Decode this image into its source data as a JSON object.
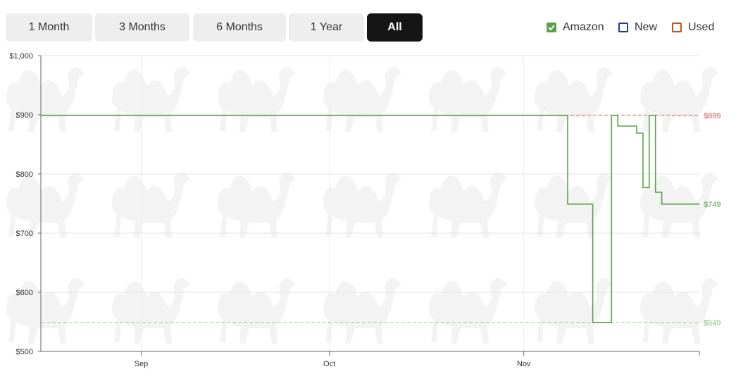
{
  "range_buttons": [
    {
      "label": "1 Month",
      "active": false
    },
    {
      "label": "3 Months",
      "active": false
    },
    {
      "label": "6 Months",
      "active": false
    },
    {
      "label": "1 Year",
      "active": false
    },
    {
      "label": "All",
      "active": true
    }
  ],
  "legend": [
    {
      "label": "Amazon",
      "checked": true,
      "color": "#5ba14a",
      "icon": "checkbox-checked-icon"
    },
    {
      "label": "New",
      "checked": false,
      "color": "#1f3f99",
      "icon": "checkbox-empty-icon"
    },
    {
      "label": "Used",
      "checked": false,
      "color": "#c0501c",
      "icon": "checkbox-empty-icon"
    }
  ],
  "chart_data": {
    "type": "line",
    "ylim": [
      500,
      1000
    ],
    "yticks": [
      500,
      600,
      700,
      800,
      900,
      1000
    ],
    "ytick_labels": [
      "$500",
      "$600",
      "$700",
      "$800",
      "$900",
      "$1,000"
    ],
    "xlim": [
      "2024-08-16",
      "2024-11-29"
    ],
    "xticks": [
      {
        "date": "2024-09-01",
        "label": "Sep"
      },
      {
        "date": "2024-10-01",
        "label": "Oct"
      },
      {
        "date": "2024-11-01",
        "label": "Nov"
      }
    ],
    "grid": true,
    "watermark_icon": "camel-icon",
    "series": [
      {
        "name": "Amazon",
        "color": "#5ba14a",
        "step": true,
        "points": [
          [
            "2024-08-16",
            899
          ],
          [
            "2024-11-08",
            899
          ],
          [
            "2024-11-08",
            749
          ],
          [
            "2024-11-12",
            749
          ],
          [
            "2024-11-12",
            549
          ],
          [
            "2024-11-15",
            549
          ],
          [
            "2024-11-15",
            899
          ],
          [
            "2024-11-16",
            899
          ],
          [
            "2024-11-16",
            881
          ],
          [
            "2024-11-19",
            881
          ],
          [
            "2024-11-19",
            869
          ],
          [
            "2024-11-20",
            869
          ],
          [
            "2024-11-20",
            777
          ],
          [
            "2024-11-21",
            777
          ],
          [
            "2024-11-21",
            899
          ],
          [
            "2024-11-22",
            899
          ],
          [
            "2024-11-22",
            769
          ],
          [
            "2024-11-23",
            769
          ],
          [
            "2024-11-23",
            749
          ],
          [
            "2024-11-29",
            749
          ]
        ]
      }
    ],
    "reference_lines": [
      {
        "value": 899,
        "label": "$899",
        "color": "#d9534f",
        "style": "dashed"
      },
      {
        "value": 549,
        "label": "$549",
        "color": "#7cc16a",
        "style": "dashed"
      }
    ],
    "end_labels": [
      {
        "value": 749,
        "label": "$749",
        "color": "#5ba14a"
      }
    ]
  }
}
